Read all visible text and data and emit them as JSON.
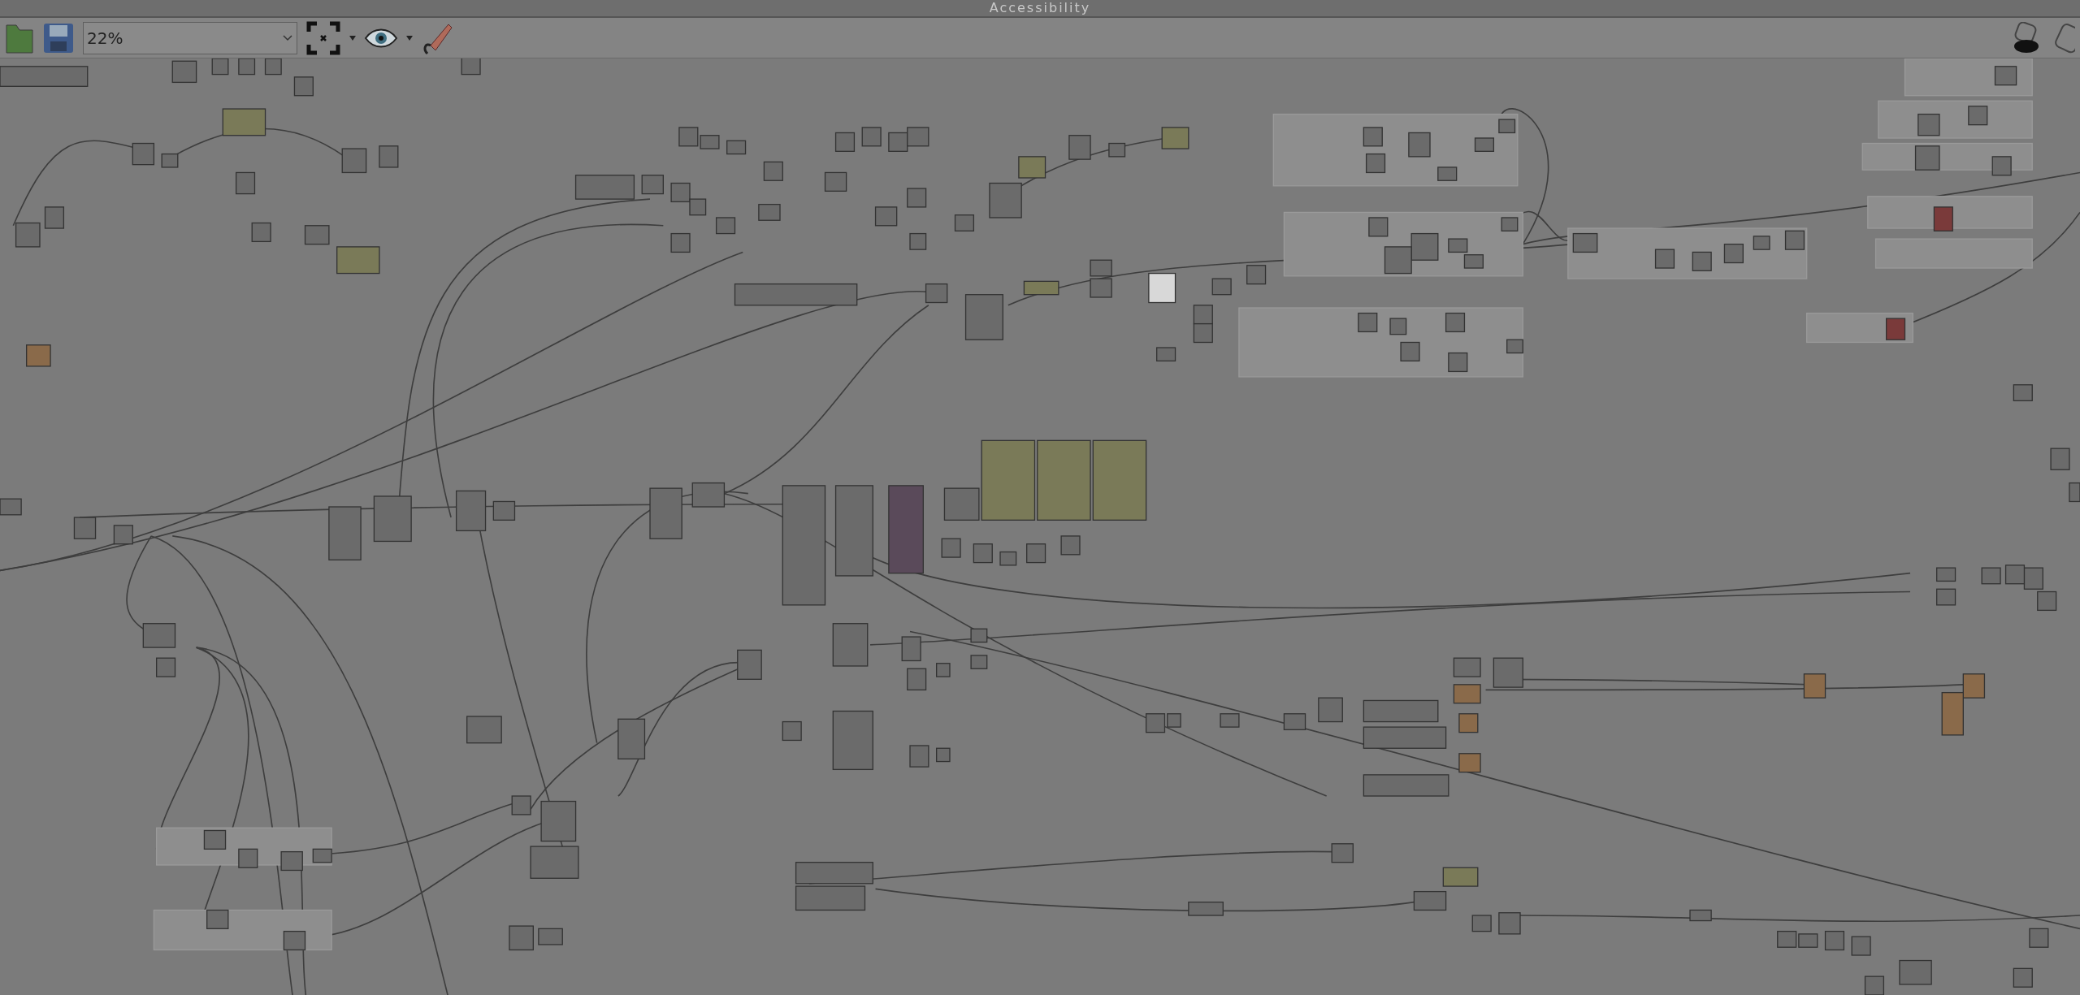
{
  "window": {
    "title": "Accessibility"
  },
  "toolbar": {
    "zoom": "22%"
  }
}
